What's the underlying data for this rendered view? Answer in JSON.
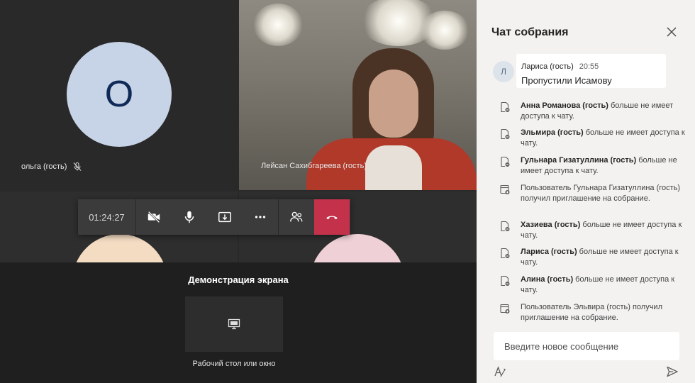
{
  "participants": {
    "olga": {
      "initial": "О",
      "name": "ольга (гость)"
    },
    "leysan": {
      "name": "Лейсан Сахибгареева (гость)"
    }
  },
  "controls": {
    "timer": "01:24:27",
    "icons": [
      "camera-off-icon",
      "microphone-icon",
      "share-tray-icon",
      "more-options-icon",
      "participants-icon",
      "hang-up-icon"
    ],
    "hangup_color": "#c4314b"
  },
  "share": {
    "title": "Демонстрация экрана",
    "option_label": "Рабочий стол или окно"
  },
  "chat": {
    "title": "Чат собрания",
    "message": {
      "avatar_initial": "Л",
      "author": "Лариса (гость)",
      "time": "20:55",
      "text": "Пропустили Исамову"
    },
    "events": [
      {
        "bold": "Анна Романова (гость)",
        "rest": " больше не имеет доступа к чату."
      },
      {
        "bold": "Эльмира (гость)",
        "rest": " больше не имеет доступа к чату."
      },
      {
        "bold": "Гульнара Гизатуллина (гость)",
        "rest": " больше не имеет доступа к чату."
      },
      {
        "bold": "",
        "rest": "Пользователь Гульнара Гизатуллина (гость) получил приглашение на собрание."
      },
      {
        "bold": "Хазиева (гость)",
        "rest": " больше не имеет доступа к чату."
      },
      {
        "bold": "Лариса (гость)",
        "rest": " больше не имеет доступа к чату."
      },
      {
        "bold": "Алина (гость)",
        "rest": " больше не имеет доступа к чату."
      },
      {
        "bold": "",
        "rest": "Пользователь Эльвира (гость) получил приглашение на собрание."
      }
    ],
    "compose_placeholder": "Введите новое сообщение"
  }
}
